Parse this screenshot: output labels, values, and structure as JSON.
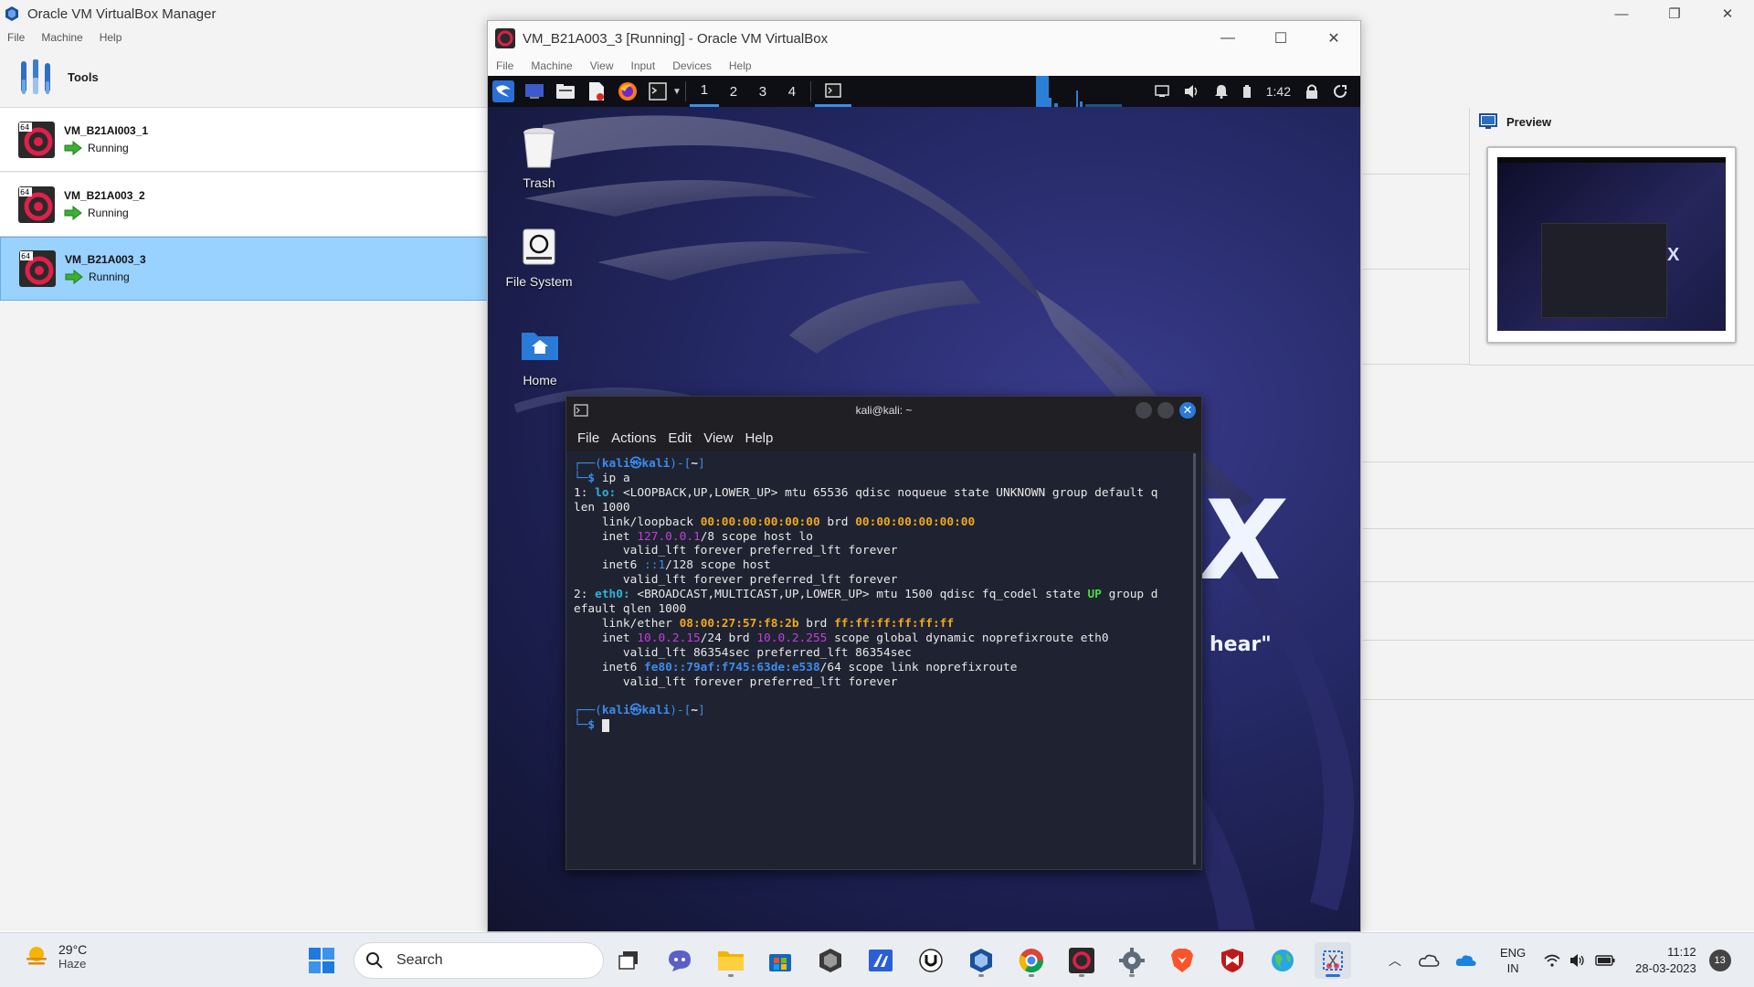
{
  "manager": {
    "title": "Oracle VM VirtualBox Manager",
    "menu": [
      "File",
      "Machine",
      "Help"
    ],
    "tools_label": "Tools",
    "vms": [
      {
        "name": "VM_B21AI003_1",
        "state": "Running",
        "selected": false
      },
      {
        "name": "VM_B21A003_2",
        "state": "Running",
        "selected": false
      },
      {
        "name": "VM_B21A003_3",
        "state": "Running",
        "selected": true
      }
    ],
    "preview_label": "Preview",
    "win_controls": [
      "—",
      "❐",
      "✕"
    ]
  },
  "vm_window": {
    "title": "VM_B21A003_3 [Running] - Oracle VM VirtualBox",
    "menu": [
      "File",
      "Machine",
      "View",
      "Input",
      "Devices",
      "Help"
    ],
    "controls": [
      "—",
      "☐",
      "✕"
    ]
  },
  "kali": {
    "workspaces": [
      "1",
      "2",
      "3",
      "4"
    ],
    "active_workspace": "1",
    "clock": "1:42",
    "desktop_icons": [
      "Trash",
      "File System",
      "Home"
    ],
    "brand_letter": "X",
    "brand_quote": "hear\""
  },
  "terminal": {
    "title": "kali@kali: ~",
    "menu": [
      "File",
      "Actions",
      "Edit",
      "View",
      "Help"
    ],
    "user": "kali",
    "host": "kali",
    "cwd": "~",
    "command": "ip a",
    "output": {
      "lo_header_a": "1: ",
      "lo_name": "lo:",
      "lo_header_b": " <LOOPBACK,UP,LOWER_UP> mtu 65536 qdisc noqueue state UNKNOWN group default q",
      "lo_header_c": "len 1000",
      "lo_link_a": "    link/loopback ",
      "lo_mac": "00:00:00:00:00:00",
      "lo_link_b": " brd ",
      "lo_brd": "00:00:00:00:00:00",
      "lo_inet_a": "    inet ",
      "lo_ip": "127.0.0.1",
      "lo_inet_b": "/8 scope host lo",
      "lo_valid1": "       valid_lft forever preferred_lft forever",
      "lo_inet6_a": "    inet6 ",
      "lo_ip6": "::1",
      "lo_inet6_b": "/128 scope host",
      "lo_valid2": "       valid_lft forever preferred_lft forever",
      "eth_header_a": "2: ",
      "eth_name": "eth0:",
      "eth_header_b": " <BROADCAST,MULTICAST,UP,LOWER_UP> mtu 1500 qdisc fq_codel state ",
      "eth_state": "UP",
      "eth_header_c": " group d",
      "eth_header_d": "efault qlen 1000",
      "eth_link_a": "    link/ether ",
      "eth_mac": "08:00:27:57:f8:2b",
      "eth_link_b": " brd ",
      "eth_brd": "ff:ff:ff:ff:ff:ff",
      "eth_inet_a": "    inet ",
      "eth_ip": "10.0.2.15",
      "eth_inet_b": "/24 brd ",
      "eth_bcast": "10.0.2.255",
      "eth_inet_c": " scope global dynamic noprefixroute eth0",
      "eth_valid1": "       valid_lft 86354sec preferred_lft 86354sec",
      "eth_inet6_a": "    inet6 ",
      "eth_ip6": "fe80::79af:f745:63de:e538",
      "eth_inet6_b": "/64 scope link noprefixroute",
      "eth_valid2": "       valid_lft forever preferred_lft forever"
    }
  },
  "taskbar": {
    "weather_temp": "29°C",
    "weather_cond": "Haze",
    "search_label": "Search",
    "lang_line1": "ENG",
    "lang_line2": "IN",
    "time": "11:12",
    "date": "28-03-2023",
    "notifications": "13"
  },
  "colors": {
    "selected_vm": "#99d1ff",
    "kali_blue": "#3c8cf0",
    "terminal_bg": "#1f2331"
  }
}
